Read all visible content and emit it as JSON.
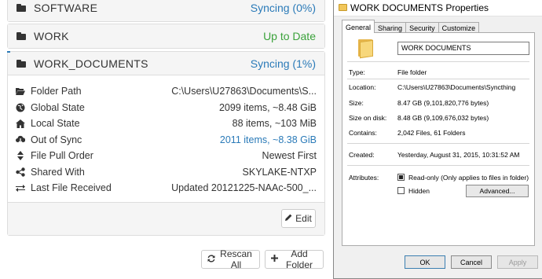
{
  "folders": {
    "software": {
      "name": "SOFTWARE",
      "status": "Syncing (0%)"
    },
    "work": {
      "name": "WORK",
      "status": "Up to Date"
    },
    "work_documents": {
      "name": "WORK_DOCUMENTS",
      "status": "Syncing (1%)",
      "details": [
        {
          "icon": "folder-open-icon",
          "label": "Folder Path",
          "value": "C:\\Users\\U27863\\Documents\\S..."
        },
        {
          "icon": "globe-icon",
          "label": "Global State",
          "value": "2099 items, ~8.48 GiB"
        },
        {
          "icon": "home-icon",
          "label": "Local State",
          "value": "88 items, ~103 MiB"
        },
        {
          "icon": "cloud-download-icon",
          "label": "Out of Sync",
          "value": "2011 items, ~8.38 GiB"
        },
        {
          "icon": "sort-icon",
          "label": "File Pull Order",
          "value": "Newest First"
        },
        {
          "icon": "share-icon",
          "label": "Shared With",
          "value": "SKYLAKE-NTXP"
        },
        {
          "icon": "exchange-icon",
          "label": "Last File Received",
          "value": "Updated 20121225-NAAc-500_..."
        }
      ],
      "edit_label": "Edit"
    }
  },
  "actions": {
    "rescan_all": "Rescan All",
    "add_folder": "Add Folder"
  },
  "dialog": {
    "title": "WORK DOCUMENTS Properties",
    "tabs": [
      "General",
      "Sharing",
      "Security",
      "Customize"
    ],
    "folder_name": "WORK DOCUMENTS",
    "type_label": "Type:",
    "type_value": "File folder",
    "location_label": "Location:",
    "location_value": "C:\\Users\\U27863\\Documents\\Syncthing",
    "size_label": "Size:",
    "size_value": "8.47 GB (9,101,820,776 bytes)",
    "size_on_disk_label": "Size on disk:",
    "size_on_disk_value": "8.48 GB (9,109,676,032 bytes)",
    "contains_label": "Contains:",
    "contains_value": "2,042 Files, 61 Folders",
    "created_label": "Created:",
    "created_value": "Yesterday, August 31, 2015, 10:31:52 AM",
    "attributes_label": "Attributes:",
    "readonly_label": "Read-only (Only applies to files in folder)",
    "hidden_label": "Hidden",
    "advanced_label": "Advanced...",
    "ok_label": "OK",
    "cancel_label": "Cancel",
    "apply_label": "Apply"
  },
  "colors": {
    "link": "#2a7ab8",
    "success": "#3ba23b",
    "panel_bg": "#f5f5f5"
  }
}
